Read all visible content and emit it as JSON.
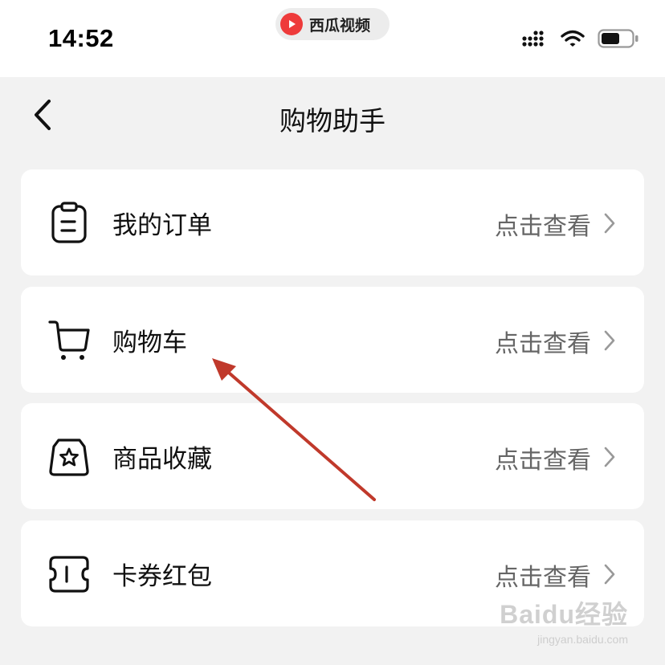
{
  "status_bar": {
    "time": "14:52",
    "app_name": "西瓜视频",
    "app_color": "#ee3b3b",
    "icons": [
      "signal-icon",
      "wifi-icon",
      "battery-icon"
    ]
  },
  "header": {
    "title": "购物助手",
    "back_icon": "back-chevron-icon"
  },
  "items": [
    {
      "label": "我的订单",
      "action": "点击查看",
      "icon": "order-clipboard-icon"
    },
    {
      "label": "购物车",
      "action": "点击查看",
      "icon": "shopping-cart-icon"
    },
    {
      "label": "商品收藏",
      "action": "点击查看",
      "icon": "star-bag-icon"
    },
    {
      "label": "卡券红包",
      "action": "点击查看",
      "icon": "coupon-icon"
    }
  ],
  "annotation": {
    "color": "#c0392b"
  },
  "watermark": {
    "main": "Baidu经验",
    "sub": "jingyan.baidu.com"
  }
}
